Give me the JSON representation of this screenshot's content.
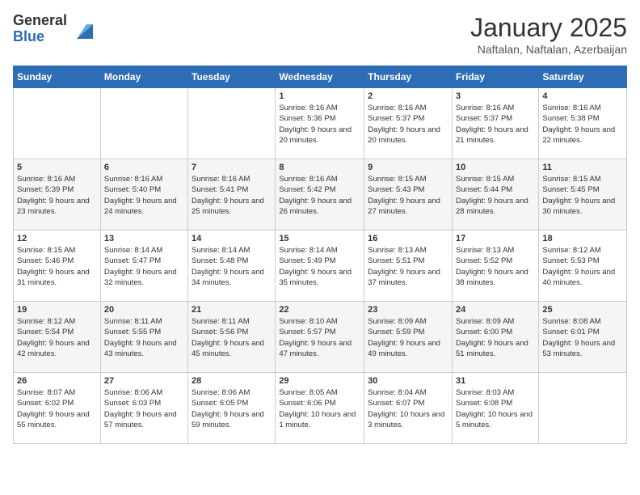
{
  "logo": {
    "general": "General",
    "blue": "Blue"
  },
  "title": {
    "month": "January 2025",
    "location": "Naftalan, Naftalan, Azerbaijan"
  },
  "weekdays": [
    "Sunday",
    "Monday",
    "Tuesday",
    "Wednesday",
    "Thursday",
    "Friday",
    "Saturday"
  ],
  "weeks": [
    [
      {
        "day": "",
        "sunrise": "",
        "sunset": "",
        "daylight": ""
      },
      {
        "day": "",
        "sunrise": "",
        "sunset": "",
        "daylight": ""
      },
      {
        "day": "",
        "sunrise": "",
        "sunset": "",
        "daylight": ""
      },
      {
        "day": "1",
        "sunrise": "Sunrise: 8:16 AM",
        "sunset": "Sunset: 5:36 PM",
        "daylight": "Daylight: 9 hours and 20 minutes."
      },
      {
        "day": "2",
        "sunrise": "Sunrise: 8:16 AM",
        "sunset": "Sunset: 5:37 PM",
        "daylight": "Daylight: 9 hours and 20 minutes."
      },
      {
        "day": "3",
        "sunrise": "Sunrise: 8:16 AM",
        "sunset": "Sunset: 5:37 PM",
        "daylight": "Daylight: 9 hours and 21 minutes."
      },
      {
        "day": "4",
        "sunrise": "Sunrise: 8:16 AM",
        "sunset": "Sunset: 5:38 PM",
        "daylight": "Daylight: 9 hours and 22 minutes."
      }
    ],
    [
      {
        "day": "5",
        "sunrise": "Sunrise: 8:16 AM",
        "sunset": "Sunset: 5:39 PM",
        "daylight": "Daylight: 9 hours and 23 minutes."
      },
      {
        "day": "6",
        "sunrise": "Sunrise: 8:16 AM",
        "sunset": "Sunset: 5:40 PM",
        "daylight": "Daylight: 9 hours and 24 minutes."
      },
      {
        "day": "7",
        "sunrise": "Sunrise: 8:16 AM",
        "sunset": "Sunset: 5:41 PM",
        "daylight": "Daylight: 9 hours and 25 minutes."
      },
      {
        "day": "8",
        "sunrise": "Sunrise: 8:16 AM",
        "sunset": "Sunset: 5:42 PM",
        "daylight": "Daylight: 9 hours and 26 minutes."
      },
      {
        "day": "9",
        "sunrise": "Sunrise: 8:15 AM",
        "sunset": "Sunset: 5:43 PM",
        "daylight": "Daylight: 9 hours and 27 minutes."
      },
      {
        "day": "10",
        "sunrise": "Sunrise: 8:15 AM",
        "sunset": "Sunset: 5:44 PM",
        "daylight": "Daylight: 9 hours and 28 minutes."
      },
      {
        "day": "11",
        "sunrise": "Sunrise: 8:15 AM",
        "sunset": "Sunset: 5:45 PM",
        "daylight": "Daylight: 9 hours and 30 minutes."
      }
    ],
    [
      {
        "day": "12",
        "sunrise": "Sunrise: 8:15 AM",
        "sunset": "Sunset: 5:46 PM",
        "daylight": "Daylight: 9 hours and 31 minutes."
      },
      {
        "day": "13",
        "sunrise": "Sunrise: 8:14 AM",
        "sunset": "Sunset: 5:47 PM",
        "daylight": "Daylight: 9 hours and 32 minutes."
      },
      {
        "day": "14",
        "sunrise": "Sunrise: 8:14 AM",
        "sunset": "Sunset: 5:48 PM",
        "daylight": "Daylight: 9 hours and 34 minutes."
      },
      {
        "day": "15",
        "sunrise": "Sunrise: 8:14 AM",
        "sunset": "Sunset: 5:49 PM",
        "daylight": "Daylight: 9 hours and 35 minutes."
      },
      {
        "day": "16",
        "sunrise": "Sunrise: 8:13 AM",
        "sunset": "Sunset: 5:51 PM",
        "daylight": "Daylight: 9 hours and 37 minutes."
      },
      {
        "day": "17",
        "sunrise": "Sunrise: 8:13 AM",
        "sunset": "Sunset: 5:52 PM",
        "daylight": "Daylight: 9 hours and 38 minutes."
      },
      {
        "day": "18",
        "sunrise": "Sunrise: 8:12 AM",
        "sunset": "Sunset: 5:53 PM",
        "daylight": "Daylight: 9 hours and 40 minutes."
      }
    ],
    [
      {
        "day": "19",
        "sunrise": "Sunrise: 8:12 AM",
        "sunset": "Sunset: 5:54 PM",
        "daylight": "Daylight: 9 hours and 42 minutes."
      },
      {
        "day": "20",
        "sunrise": "Sunrise: 8:11 AM",
        "sunset": "Sunset: 5:55 PM",
        "daylight": "Daylight: 9 hours and 43 minutes."
      },
      {
        "day": "21",
        "sunrise": "Sunrise: 8:11 AM",
        "sunset": "Sunset: 5:56 PM",
        "daylight": "Daylight: 9 hours and 45 minutes."
      },
      {
        "day": "22",
        "sunrise": "Sunrise: 8:10 AM",
        "sunset": "Sunset: 5:57 PM",
        "daylight": "Daylight: 9 hours and 47 minutes."
      },
      {
        "day": "23",
        "sunrise": "Sunrise: 8:09 AM",
        "sunset": "Sunset: 5:59 PM",
        "daylight": "Daylight: 9 hours and 49 minutes."
      },
      {
        "day": "24",
        "sunrise": "Sunrise: 8:09 AM",
        "sunset": "Sunset: 6:00 PM",
        "daylight": "Daylight: 9 hours and 51 minutes."
      },
      {
        "day": "25",
        "sunrise": "Sunrise: 8:08 AM",
        "sunset": "Sunset: 6:01 PM",
        "daylight": "Daylight: 9 hours and 53 minutes."
      }
    ],
    [
      {
        "day": "26",
        "sunrise": "Sunrise: 8:07 AM",
        "sunset": "Sunset: 6:02 PM",
        "daylight": "Daylight: 9 hours and 55 minutes."
      },
      {
        "day": "27",
        "sunrise": "Sunrise: 8:06 AM",
        "sunset": "Sunset: 6:03 PM",
        "daylight": "Daylight: 9 hours and 57 minutes."
      },
      {
        "day": "28",
        "sunrise": "Sunrise: 8:06 AM",
        "sunset": "Sunset: 6:05 PM",
        "daylight": "Daylight: 9 hours and 59 minutes."
      },
      {
        "day": "29",
        "sunrise": "Sunrise: 8:05 AM",
        "sunset": "Sunset: 6:06 PM",
        "daylight": "Daylight: 10 hours and 1 minute."
      },
      {
        "day": "30",
        "sunrise": "Sunrise: 8:04 AM",
        "sunset": "Sunset: 6:07 PM",
        "daylight": "Daylight: 10 hours and 3 minutes."
      },
      {
        "day": "31",
        "sunrise": "Sunrise: 8:03 AM",
        "sunset": "Sunset: 6:08 PM",
        "daylight": "Daylight: 10 hours and 5 minutes."
      },
      {
        "day": "",
        "sunrise": "",
        "sunset": "",
        "daylight": ""
      }
    ]
  ]
}
